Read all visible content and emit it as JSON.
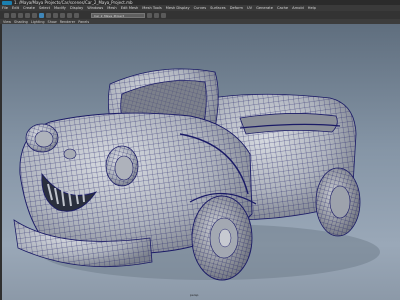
{
  "window": {
    "title": "1. /Maya/Maya Projects/Car/scenes/Car_2_Maya_Project.mb"
  },
  "menubar": {
    "items": [
      "File",
      "Edit",
      "Create",
      "Select",
      "Modify",
      "Display",
      "Windows",
      "Mesh",
      "Edit Mesh",
      "Mesh Tools",
      "Mesh Display",
      "Curves",
      "Surfaces",
      "Deform",
      "UV",
      "Generate",
      "Cache",
      "Arnold",
      "Help"
    ]
  },
  "toolbar": {
    "status_field": "Car_2_Maya_Project"
  },
  "panel_menu": {
    "items": [
      "View",
      "Shading",
      "Lighting",
      "Show",
      "Renderer",
      "Panels"
    ]
  },
  "viewport": {
    "camera_label": "persp"
  },
  "colors": {
    "wire": "#1a1a66",
    "body": "#b9bdc6",
    "accent": "#3f86b8"
  }
}
